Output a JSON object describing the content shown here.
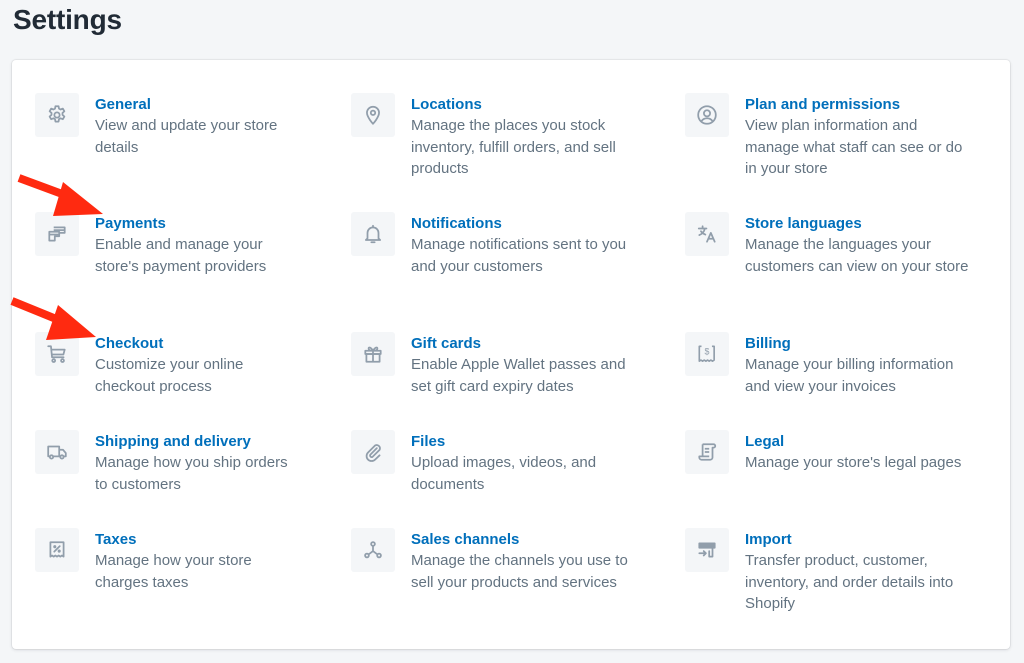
{
  "page": {
    "title": "Settings"
  },
  "colors": {
    "link": "#006fbb",
    "description": "#637381",
    "icon": "#919eab",
    "annotation_arrow": "#ff2a10"
  },
  "settings": [
    {
      "id": "general",
      "icon": "gear-icon",
      "title": "General",
      "description": "View and update your store details"
    },
    {
      "id": "payments",
      "icon": "payments-icon",
      "title": "Payments",
      "description": "Enable and manage your store's payment providers"
    },
    {
      "id": "checkout",
      "icon": "cart-icon",
      "title": "Checkout",
      "description": "Customize your online checkout process"
    },
    {
      "id": "shipping",
      "icon": "truck-icon",
      "title": "Shipping and delivery",
      "description": "Manage how you ship orders to customers"
    },
    {
      "id": "taxes",
      "icon": "tax-receipt-icon",
      "title": "Taxes",
      "description": "Manage how your store charges taxes"
    },
    {
      "id": "locations",
      "icon": "location-pin-icon",
      "title": "Locations",
      "description": "Manage the places you stock inventory, fulfill orders, and sell products"
    },
    {
      "id": "notifications",
      "icon": "bell-icon",
      "title": "Notifications",
      "description": "Manage notifications sent to you and your customers"
    },
    {
      "id": "gift-cards",
      "icon": "gift-icon",
      "title": "Gift cards",
      "description": "Enable Apple Wallet passes and set gift card expiry dates"
    },
    {
      "id": "files",
      "icon": "paperclip-icon",
      "title": "Files",
      "description": "Upload images, videos, and documents"
    },
    {
      "id": "sales-channels",
      "icon": "channels-icon",
      "title": "Sales channels",
      "description": "Manage the channels you use to sell your products and services"
    },
    {
      "id": "plan",
      "icon": "user-circle-icon",
      "title": "Plan and permissions",
      "description": "View plan information and manage what staff can see or do in your store"
    },
    {
      "id": "languages",
      "icon": "translate-icon",
      "title": "Store languages",
      "description": "Manage the languages your customers can view on your store"
    },
    {
      "id": "billing",
      "icon": "billing-icon",
      "title": "Billing",
      "description": "Manage your billing information and view your invoices"
    },
    {
      "id": "legal",
      "icon": "legal-document-icon",
      "title": "Legal",
      "description": "Manage your store's legal pages"
    },
    {
      "id": "import",
      "icon": "import-store-icon",
      "title": "Import",
      "description": "Transfer product, customer, inventory, and order details into Shopify"
    }
  ],
  "annotations": [
    {
      "type": "arrow",
      "points_to": "Payments"
    },
    {
      "type": "arrow",
      "points_to": "Checkout"
    }
  ]
}
